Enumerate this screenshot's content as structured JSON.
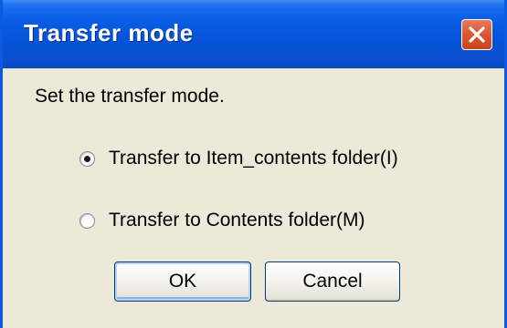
{
  "window": {
    "title": "Transfer mode",
    "close_icon": "close-icon"
  },
  "dialog": {
    "prompt": "Set the transfer mode.",
    "options": [
      {
        "label": "Transfer to Item_contents folder(I)",
        "selected": true
      },
      {
        "label": "Transfer to Contents folder(M)",
        "selected": false
      }
    ],
    "buttons": {
      "ok_label": "OK",
      "cancel_label": "Cancel"
    }
  },
  "colors": {
    "titlebar": "#0553d8",
    "close_button": "#db5a35",
    "dialog_background": "#ece9d8"
  }
}
